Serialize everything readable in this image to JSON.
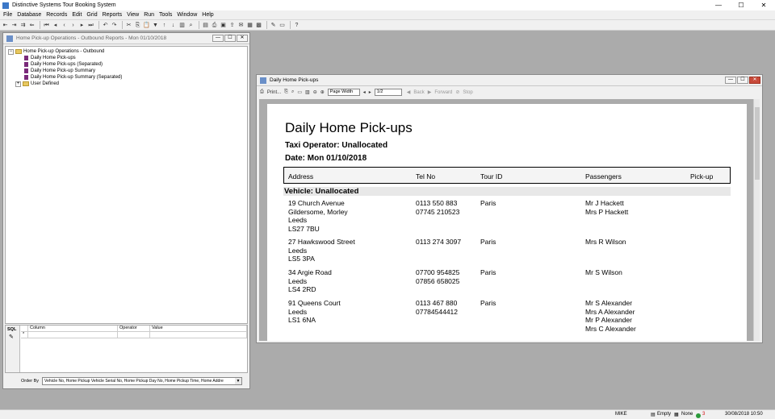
{
  "app": {
    "title": "Distinctive Systems Tour Booking System",
    "window_controls": [
      "—",
      "☐",
      "✕"
    ]
  },
  "menu": [
    "File",
    "Database",
    "Records",
    "Edit",
    "Grid",
    "Reports",
    "View",
    "Run",
    "Tools",
    "Window",
    "Help"
  ],
  "left_window": {
    "title": "Home Pick-up Operations - Outbound Reports - Mon 01/10/2018",
    "tree": {
      "root": "Home Pick-up Operations - Outbound",
      "items": [
        "Daily Home Pick-ups",
        "Daily Home Pick-ups (Separated)",
        "Daily Home Pick-up Summary",
        "Daily Home Pick-up Summary (Separated)"
      ],
      "user_defined": "User Defined"
    },
    "sql": {
      "label": "SQL",
      "columns": [
        "Column",
        "Operator",
        "Value"
      ],
      "row_marker": "*"
    },
    "order_by": {
      "label": "Order By",
      "value": "Vehicle No, Home Pickup Vehicle Serial No, Home Pickup Day No, Home Pickup Time, Home Addre"
    }
  },
  "report_window": {
    "title": "Daily Home Pick-ups",
    "toolbar": {
      "print": "Print...",
      "zoom": "Page Width",
      "page": "1/2",
      "back": "Back",
      "forward": "Forward",
      "stop": "Stop"
    },
    "report": {
      "title": "Daily Home Pick-ups",
      "operator": "Taxi Operator: Unallocated",
      "date": "Date: Mon 01/10/2018",
      "columns": [
        "Address",
        "Tel No",
        "Tour ID",
        "Passengers",
        "Pick-up"
      ],
      "vehicle": "Vehicle: Unallocated",
      "rows": [
        {
          "address": [
            "19 Church Avenue",
            "Gildersome, Morley",
            "Leeds",
            "LS27 7BU"
          ],
          "tel": [
            "0113 550 883",
            "07745 210523"
          ],
          "tour": "Paris",
          "passengers": [
            "Mr J Hackett",
            "Mrs P Hackett"
          ]
        },
        {
          "address": [
            "27 Hawkswood Street",
            "Leeds",
            "LS5 3PA"
          ],
          "tel": [
            "0113 274 3097"
          ],
          "tour": "Paris",
          "passengers": [
            "Mrs R Wilson"
          ]
        },
        {
          "address": [
            "34 Argie Road",
            "Leeds",
            "LS4 2RD"
          ],
          "tel": [
            "07700 954825",
            "07856 658025"
          ],
          "tour": "Paris",
          "passengers": [
            "Mr S Wilson"
          ]
        },
        {
          "address": [
            "91 Queens Court",
            "Leeds",
            "LS1 6NA"
          ],
          "tel": [
            "0113 467 880",
            "07784544412"
          ],
          "tour": "Paris",
          "passengers": [
            "Mr S Alexander",
            "Mrs A Alexander",
            "Mr P Alexander",
            "Mrs C Alexander"
          ]
        }
      ]
    }
  },
  "status_bar": {
    "user": "MIKE",
    "clipboard": "Empty",
    "filter": "None",
    "count": "3",
    "datetime": "30/08/2018 10:50"
  },
  "colors": {
    "workspace": "#ababab",
    "chrome": "#f0f0f0",
    "close_red": "#c84a3a",
    "tree_doc": "#7a2a7a"
  }
}
